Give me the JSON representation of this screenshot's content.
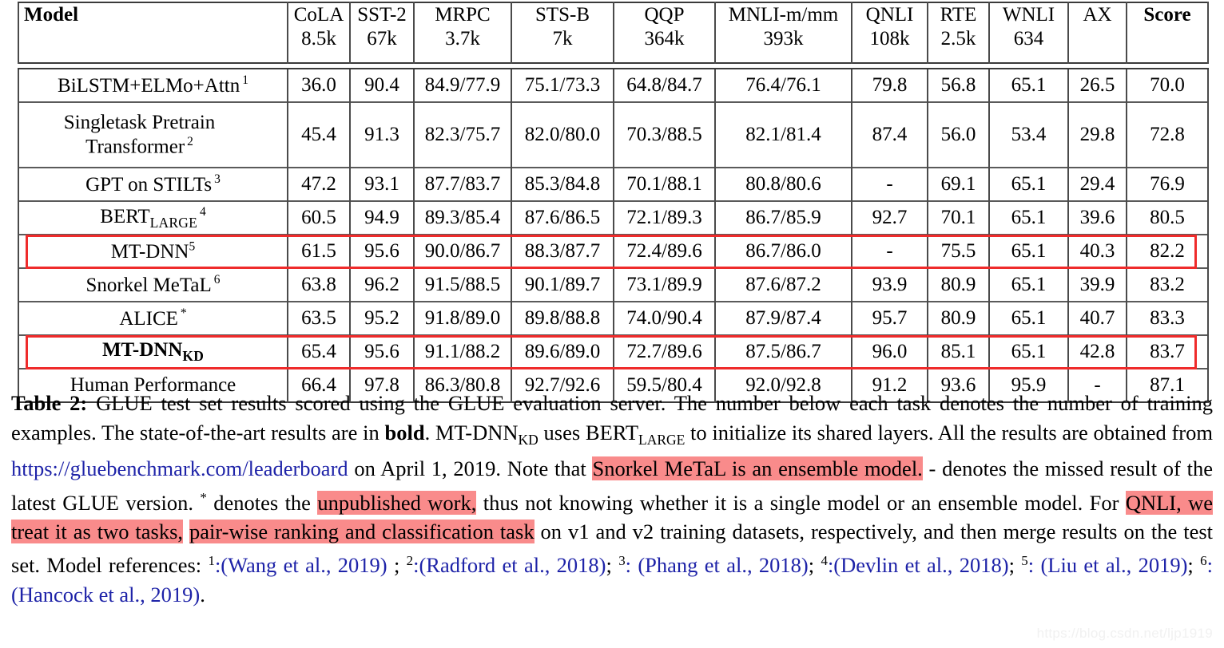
{
  "table": {
    "columns": [
      {
        "name": "Model",
        "sub": "",
        "bold": true
      },
      {
        "name": "CoLA",
        "sub": "8.5k",
        "bold": false
      },
      {
        "name": "SST-2",
        "sub": "67k",
        "bold": false
      },
      {
        "name": "MRPC",
        "sub": "3.7k",
        "bold": false
      },
      {
        "name": "STS-B",
        "sub": "7k",
        "bold": false
      },
      {
        "name": "QQP",
        "sub": "364k",
        "bold": false
      },
      {
        "name": "MNLI-m/mm",
        "sub": "393k",
        "bold": false
      },
      {
        "name": "QNLI",
        "sub": "108k",
        "bold": false
      },
      {
        "name": "RTE",
        "sub": "2.5k",
        "bold": false
      },
      {
        "name": "WNLI",
        "sub": "634",
        "bold": false
      },
      {
        "name": "AX",
        "sub": "",
        "bold": false
      },
      {
        "name": "Score",
        "sub": "",
        "bold": true
      }
    ],
    "rows": [
      {
        "model": "BiLSTM+ELMo+Attn",
        "ref": "1",
        "model_bold": false,
        "values": [
          "36.0",
          "90.4",
          "84.9/77.9",
          "75.1/73.3",
          "64.8/84.7",
          "76.4/76.1",
          "79.8",
          "56.8",
          "65.1",
          "26.5",
          "70.0"
        ],
        "bold_flags": [
          false,
          false,
          false,
          false,
          false,
          false,
          false,
          false,
          false,
          false,
          false
        ],
        "highlight": false
      },
      {
        "model": "Singletask Pretrain Transformer",
        "model_line1": "Singletask Pretrain",
        "model_line2": "Transformer",
        "ref": "2",
        "model_bold": false,
        "values": [
          "45.4",
          "91.3",
          "82.3/75.7",
          "82.0/80.0",
          "70.3/88.5",
          "82.1/81.4",
          "87.4",
          "56.0",
          "53.4",
          "29.8",
          "72.8"
        ],
        "bold_flags": [
          false,
          false,
          false,
          false,
          false,
          false,
          false,
          false,
          false,
          false,
          false
        ],
        "highlight": false
      },
      {
        "model": "GPT on STILTs",
        "ref": "3",
        "model_bold": false,
        "values": [
          "47.2",
          "93.1",
          "87.7/83.7",
          "85.3/84.8",
          "70.1/88.1",
          "80.8/80.6",
          "-",
          "69.1",
          "65.1",
          "29.4",
          "76.9"
        ],
        "bold_flags": [
          false,
          false,
          false,
          false,
          false,
          false,
          false,
          false,
          false,
          false,
          false
        ],
        "highlight": false
      },
      {
        "model": "BERT",
        "model_subscript": "LARGE",
        "ref": "4",
        "model_bold": false,
        "values": [
          "60.5",
          "94.9",
          "89.3/85.4",
          "87.6/86.5",
          "72.1/89.3",
          "86.7/85.9",
          "92.7",
          "70.1",
          "65.1",
          "39.6",
          "80.5"
        ],
        "bold_flags": [
          false,
          false,
          false,
          false,
          false,
          false,
          false,
          false,
          false,
          false,
          false
        ],
        "highlight": false
      },
      {
        "model": "MT-DNN",
        "ref": "5",
        "ref_tight": true,
        "model_bold": false,
        "values": [
          "61.5",
          "95.6",
          "90.0/86.7",
          "88.3/87.7",
          "72.4/89.6",
          "86.7/86.0",
          "-",
          "75.5",
          "65.1",
          "40.3",
          "82.2"
        ],
        "bold_flags": [
          false,
          false,
          false,
          false,
          false,
          false,
          false,
          false,
          false,
          false,
          false
        ],
        "highlight": true
      },
      {
        "model": "Snorkel MeTaL",
        "ref": "6",
        "model_bold": false,
        "values": [
          "63.8",
          "96.2",
          "91.5/88.5",
          "90.1/89.7",
          "73.1/89.9",
          "87.6/87.2",
          "93.9",
          "80.9",
          "65.1",
          "39.9",
          "83.2"
        ],
        "bold_flags": [
          false,
          true,
          false,
          true,
          false,
          false,
          false,
          false,
          false,
          false,
          false
        ],
        "highlight": false
      },
      {
        "model": "ALICE",
        "ref": "*",
        "model_bold": false,
        "values": [
          "63.5",
          "95.2",
          "91.8/89.0",
          "89.8/88.8",
          "74.0/90.4",
          "87.9/87.4",
          "95.7",
          "80.9",
          "65.1",
          "40.7",
          "83.3"
        ],
        "bold_flags": [
          false,
          false,
          true,
          false,
          true,
          true,
          false,
          false,
          false,
          false,
          false
        ],
        "highlight": false
      },
      {
        "model": "MT-DNN",
        "model_subscript": "KD",
        "ref": "",
        "model_bold": true,
        "values": [
          "65.4",
          "95.6",
          "91.1/88.2",
          "89.6/89.0",
          "72.7/89.6",
          "87.5/86.7",
          "96.0",
          "85.1",
          "65.1",
          "42.8",
          "83.7"
        ],
        "bold_flags": [
          true,
          false,
          false,
          false,
          false,
          false,
          true,
          true,
          false,
          true,
          true
        ],
        "highlight": true
      },
      {
        "model": "Human Performance",
        "ref": "",
        "model_bold": false,
        "values": [
          "66.4",
          "97.8",
          "86.3/80.8",
          "92.7/92.6",
          "59.5/80.4",
          "92.0/92.8",
          "91.2",
          "93.6",
          "95.9",
          "-",
          "87.1"
        ],
        "bold_flags": [
          false,
          false,
          false,
          false,
          false,
          false,
          false,
          false,
          false,
          false,
          false
        ],
        "highlight": false
      }
    ]
  },
  "caption": {
    "label": "Table 2:",
    "s1": " GLUE test set results scored using the GLUE evaluation server. The number below each task denotes the number of training examples. The state-of-the-art results are in ",
    "bold1": "bold",
    "s2": ". MT-DNN",
    "sub1": "KD",
    "s3": " uses BERT",
    "sub2": "LARGE",
    "s4": " to initialize its shared layers. All the results are obtained from ",
    "link": "https://gluebenchmark.com/leaderboard",
    "s5": " on April 1, 2019. Note that ",
    "hl1": "Snorkel MeTaL is an ensemble model.",
    "s6": " - denotes the missed result of the latest GLUE version. ",
    "star": "*",
    "s7": " denotes the ",
    "hl2": "unpublished work,",
    "s8": " thus not knowing whether it is a single model or an ensemble model. For ",
    "hl3": "QNLI, we treat it as two tasks,",
    "hl4": "pair-wise ranking and classification task",
    "s9": " on v1 and v2 training datasets, respectively, and then merge results on the test set. Model references: ",
    "ref1_sup": "1",
    "ref1": ":(Wang et al., 2019)",
    "sep1": " ; ",
    "ref2_sup": "2",
    "ref2": ":(Radford et al., 2018)",
    "sep2": "; ",
    "ref3_sup": "3",
    "ref3": ": (Phang et al., 2018)",
    "sep3": "; ",
    "ref4_sup": "4",
    "ref4": ":(Devlin et al., 2018)",
    "sep4": "; ",
    "ref5_sup": "5",
    "ref5": ": (Liu et al., 2019)",
    "sep5": "; ",
    "ref6_sup": "6",
    "ref6": ": (Hancock et al., 2019)",
    "end": "."
  },
  "watermark": "https://blog.csdn.net/ljp1919",
  "colors": {
    "highlight_box": "#ef2b2b",
    "text_highlight": "#f98b8b",
    "link": "#1e23a8",
    "rule": "#3a3a3a"
  }
}
